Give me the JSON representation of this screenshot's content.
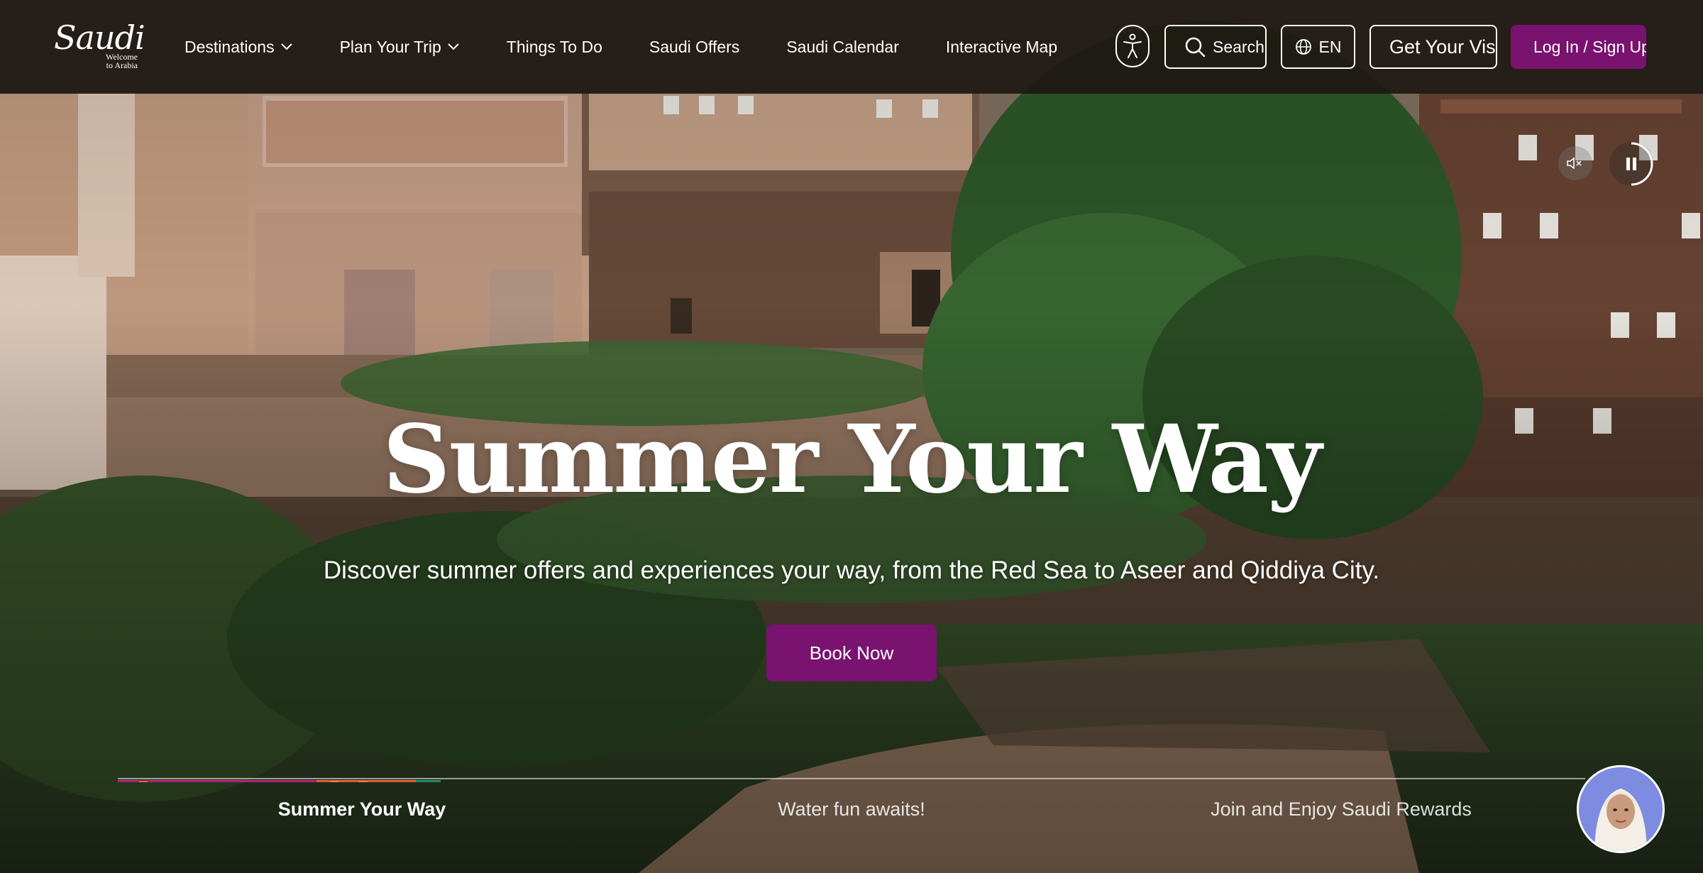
{
  "header": {
    "logo": {
      "wordmark": "Saudi",
      "tagline_line1": "Welcome",
      "tagline_line2": "to Arabia"
    },
    "nav": [
      {
        "label": "Destinations",
        "has_dropdown": true
      },
      {
        "label": "Plan Your Trip",
        "has_dropdown": true
      },
      {
        "label": "Things To Do",
        "has_dropdown": false
      },
      {
        "label": "Saudi Offers",
        "has_dropdown": false
      },
      {
        "label": "Saudi Calendar",
        "has_dropdown": false
      },
      {
        "label": "Interactive Map",
        "has_dropdown": false
      }
    ],
    "accessibility_icon": "accessibility-person-icon",
    "search_label": "Search",
    "language_label": "EN",
    "visa_label": "Get Your Visa",
    "login_label": "Log In / Sign Up"
  },
  "media": {
    "mute_icon": "speaker-muted-icon",
    "pause_icon": "pause-icon"
  },
  "hero": {
    "title": "Summer Your Way",
    "subtitle": "Discover summer offers and experiences your way, from the Red Sea to Aseer and Qiddiya City.",
    "cta_label": "Book Now"
  },
  "slides": {
    "active_index": 0,
    "progress": 0.22,
    "tabs": [
      {
        "label": "Summer Your Way"
      },
      {
        "label": "Water fun awaits!"
      },
      {
        "label": "Join and Enjoy Saudi Rewards"
      }
    ]
  },
  "chat": {
    "icon": "assistant-avatar-icon"
  },
  "colors": {
    "brand_purple": "#7a1270",
    "header_bg": "#1e1814"
  }
}
